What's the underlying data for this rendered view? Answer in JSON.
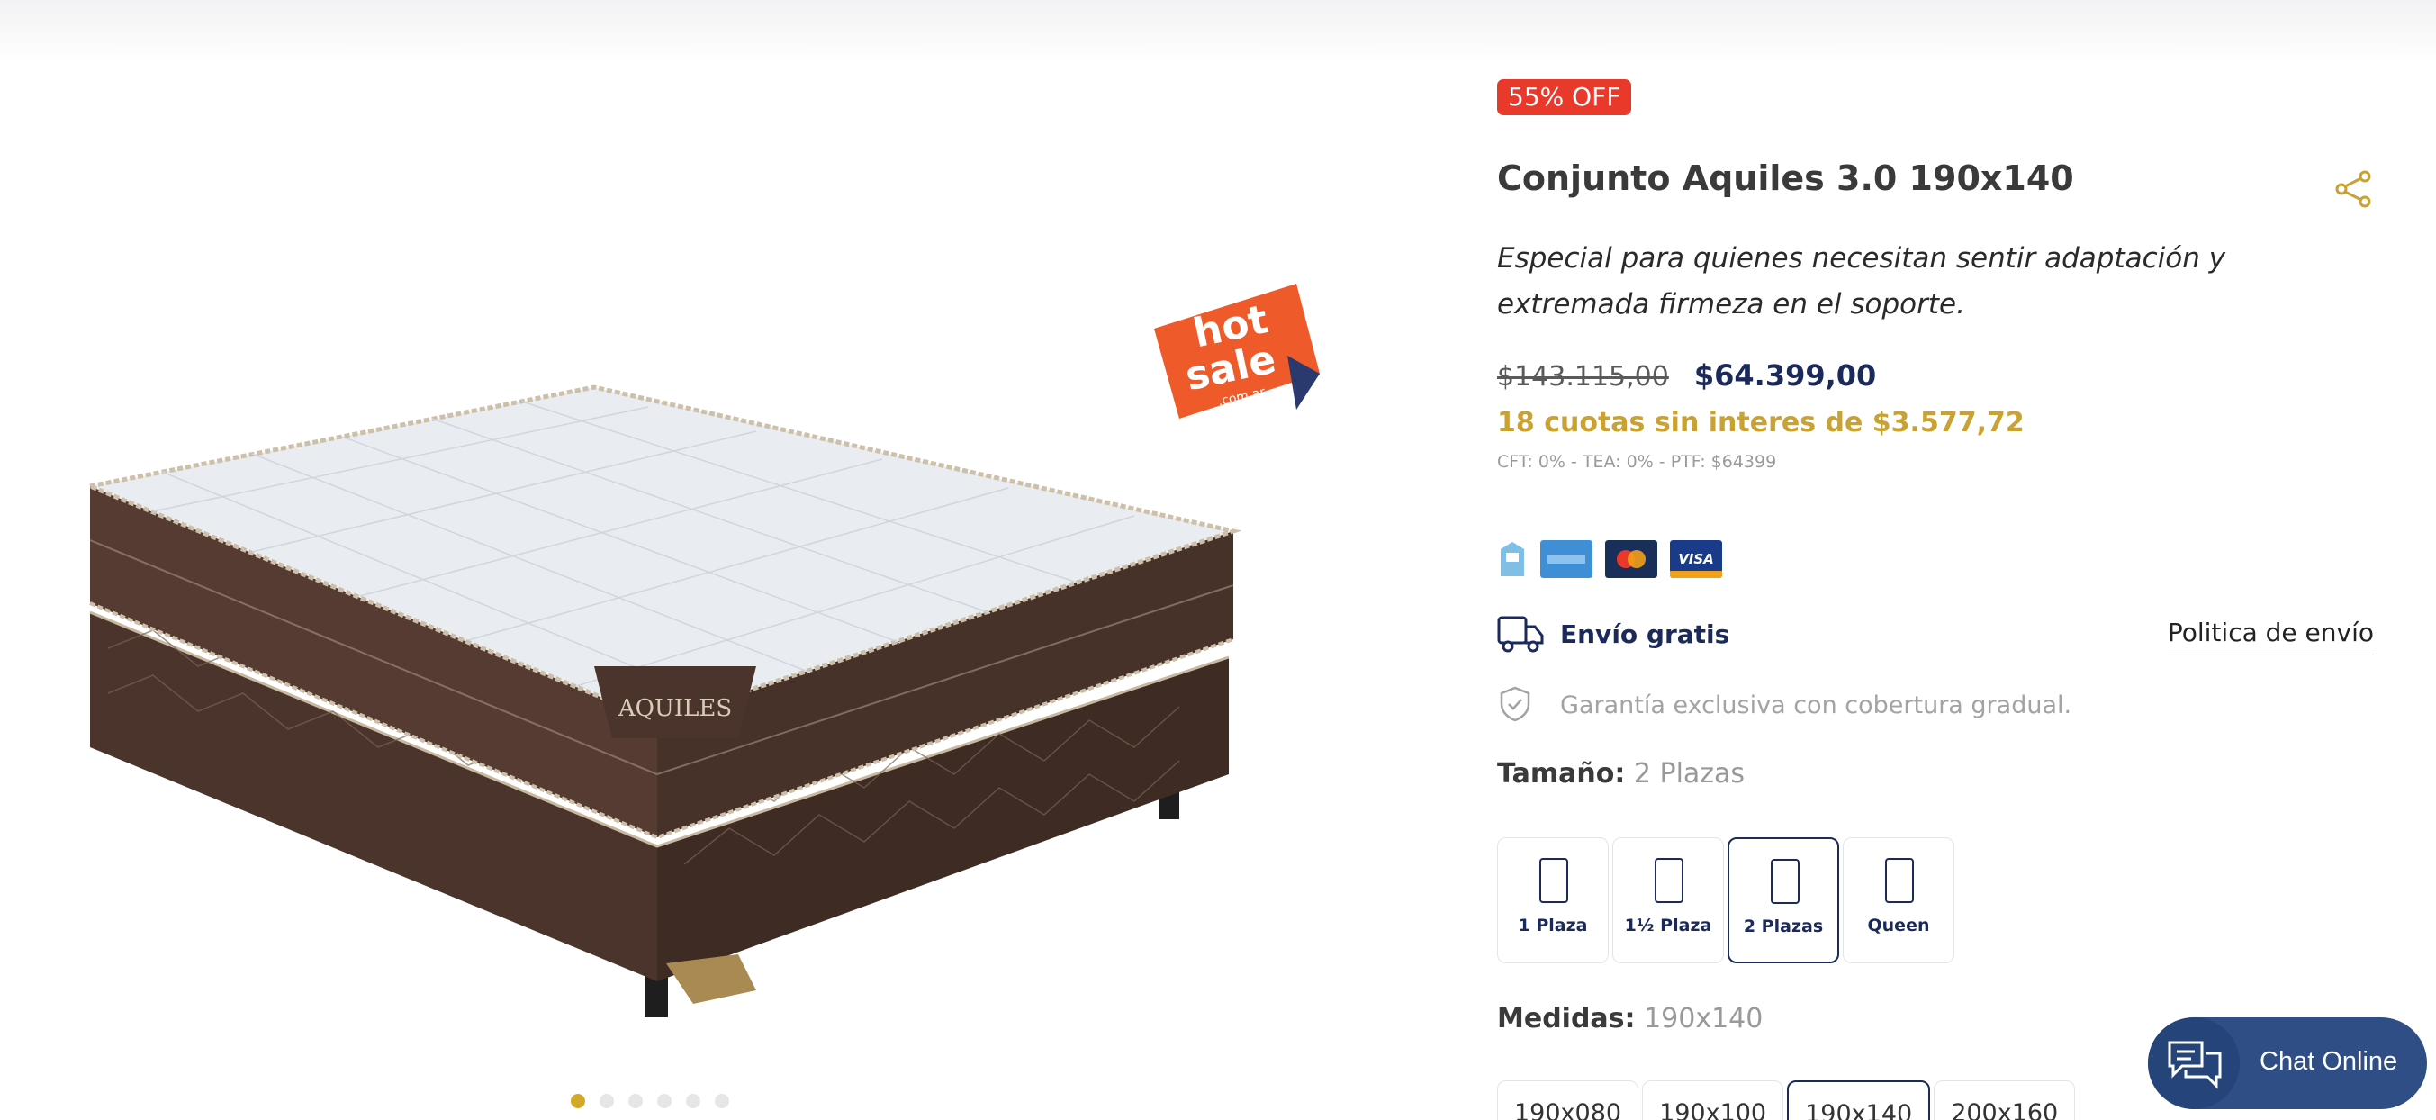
{
  "product": {
    "discount_badge": "55% OFF",
    "title": "Conjunto Aquiles 3.0 190x140",
    "description": "Especial para quienes necesitan sentir adaptación y extremada firmeza en el soporte.",
    "old_price": "$143.115,00",
    "new_price": "$64.399,00",
    "installments": "18 cuotas sin interes de $3.577,72",
    "cft": "CFT: 0% - TEA: 0% - PTF: $64399"
  },
  "gallery": {
    "slide_count": 6,
    "active_slide": 1,
    "hot_sale_logo_text": "hot sale .com.ar",
    "mattress_brand_text": "AQUILES"
  },
  "payments": {
    "icons": [
      "ahora-18-icon",
      "amex-icon",
      "mastercard-icon",
      "visa-icon"
    ],
    "visa_text": "VISA"
  },
  "shipping": {
    "label": "Envío gratis",
    "policy_link": "Politica de envío"
  },
  "warranty": {
    "text": "Garantía exclusiva con cobertura gradual."
  },
  "size": {
    "label": "Tamaño:",
    "selected": "2 Plazas",
    "options": [
      "1 Plaza",
      "1½ Plaza",
      "2 Plazas",
      "Queen"
    ]
  },
  "measures": {
    "label": "Medidas:",
    "selected": "190x140",
    "options": [
      "190x080",
      "190x100",
      "190x140",
      "200x160"
    ]
  },
  "chat": {
    "label": "Chat Online"
  },
  "colors": {
    "accent_gold": "#c9a233",
    "navy": "#1b2a5a",
    "discount_red": "#e8392b",
    "chat_blue": "#2f4e86"
  }
}
